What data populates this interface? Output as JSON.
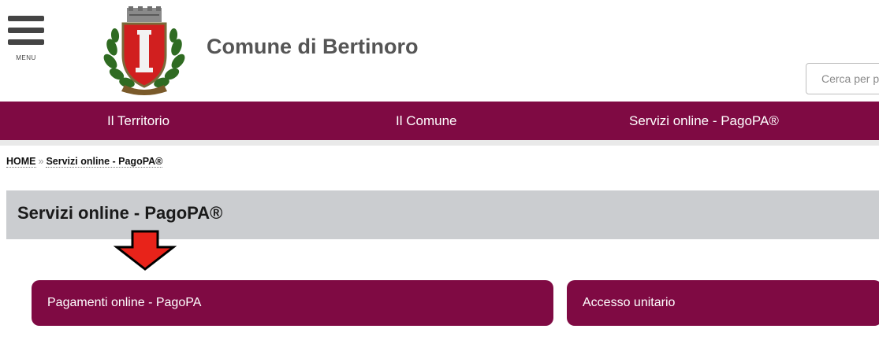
{
  "header": {
    "menu_label": "MENU",
    "site_title": "Comune di Bertinoro",
    "search_placeholder": "Cerca per parola chiave"
  },
  "colors": {
    "brand": "#7f0a43",
    "title_band": "#cbcdd0",
    "arrow": "#e8231a"
  },
  "nav": {
    "items": [
      {
        "label": "Il Territorio"
      },
      {
        "label": "Il Comune"
      },
      {
        "label": "Servizi online - PagoPA®"
      }
    ]
  },
  "breadcrumb": {
    "home": "HOME",
    "separator": "»",
    "current": "Servizi online - PagoPA®"
  },
  "page": {
    "title": "Servizi online - PagoPA®"
  },
  "cards": [
    {
      "label": "Pagamenti online - PagoPA"
    },
    {
      "label": "Accesso unitario"
    }
  ],
  "icons": {
    "menu": "hamburger-icon",
    "logo": "coat-of-arms",
    "annotation": "down-arrow-icon"
  }
}
